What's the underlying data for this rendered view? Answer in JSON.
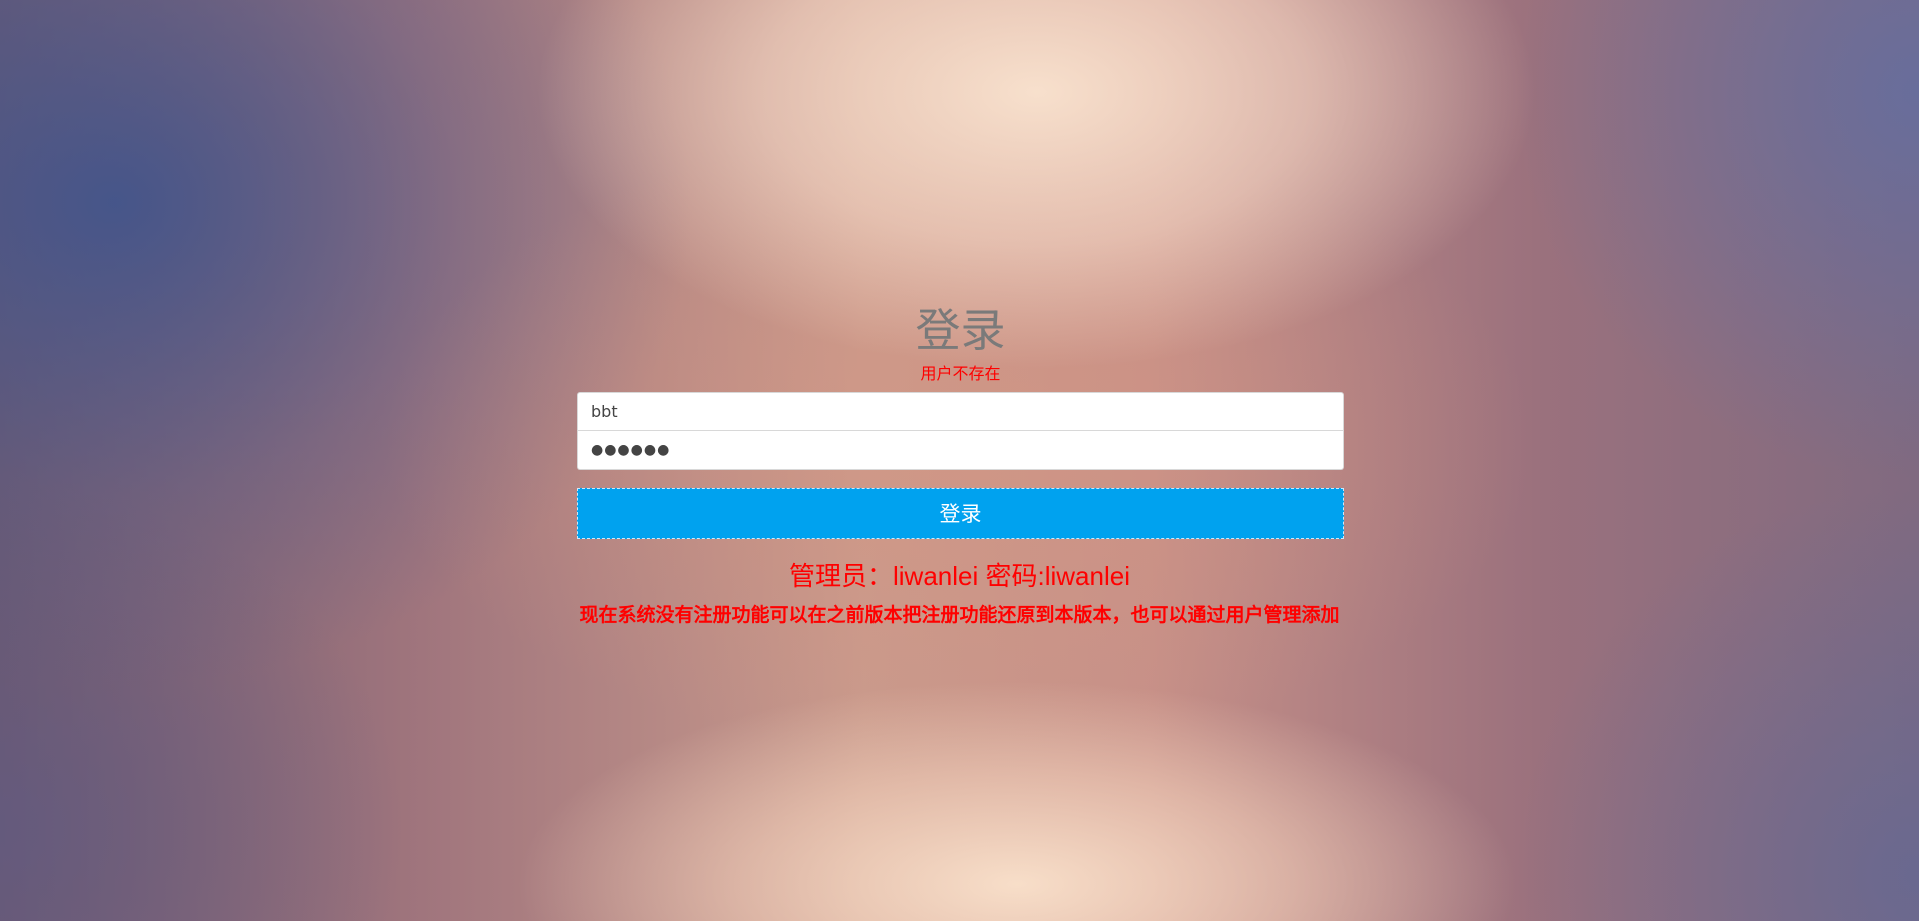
{
  "login": {
    "title": "登录",
    "error": "用户不存在",
    "username_value": "bbt",
    "password_mask": "●●●●●●",
    "submit_label": "登录"
  },
  "notices": {
    "admin": "管理员：liwanlei 密码:liwanlei",
    "info": "现在系统没有注册功能可以在之前版本把注册功能还原到本版本，也可以通过用户管理添加"
  },
  "colors": {
    "button": "#00a2ef",
    "error": "#ff0000",
    "title": "#7a7a7a"
  }
}
